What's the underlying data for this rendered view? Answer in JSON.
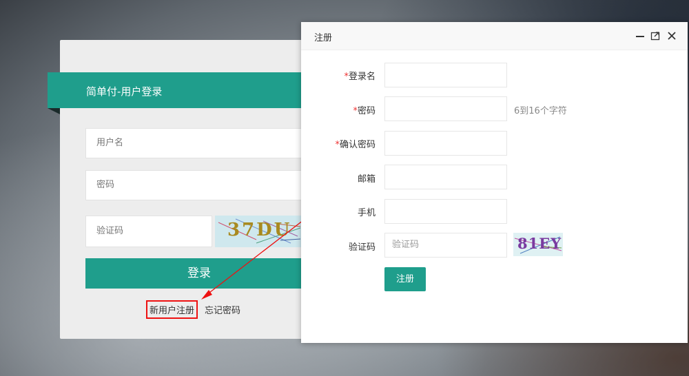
{
  "login": {
    "title": "简单付-用户登录",
    "username_placeholder": "用户名",
    "password_placeholder": "密码",
    "captcha_placeholder": "验证码",
    "captcha_text": "37DU",
    "submit_label": "登录",
    "register_link": "新用户注册",
    "forgot_link": "忘记密码"
  },
  "dialog": {
    "title": "注册",
    "fields": {
      "login_name": {
        "label": "登录名",
        "required": "*"
      },
      "password": {
        "label": "密码",
        "required": "*",
        "hint": "6到16个字符"
      },
      "confirm_password": {
        "label": "确认密码",
        "required": "*"
      },
      "email": {
        "label": "邮箱"
      },
      "phone": {
        "label": "手机"
      },
      "captcha": {
        "label": "验证码",
        "placeholder": "验证码",
        "captcha_text": "81EY"
      }
    },
    "submit_label": "注册"
  },
  "colors": {
    "accent": "#1f9e8c",
    "required": "#ee3333",
    "annotation": "#ee1111"
  }
}
